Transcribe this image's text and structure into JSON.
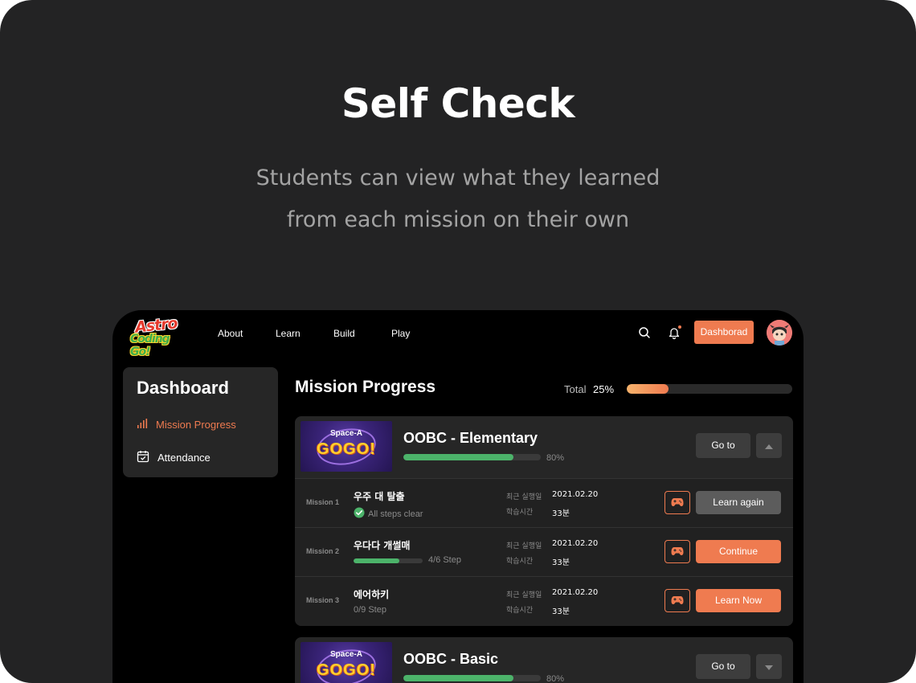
{
  "hero": {
    "title": "Self Check",
    "subtitle_line1": "Students can view what they learned",
    "subtitle_line2": "from each mission on their own"
  },
  "nav": {
    "logo_line1": "Astro",
    "logo_line2": "Coding Go!",
    "links": [
      "About",
      "Learn",
      "Build",
      "Play"
    ],
    "dashboard_button": "Dashborad",
    "accent_color": "#ef7b50"
  },
  "sidebar": {
    "title": "Dashboard",
    "items": [
      {
        "label": "Mission Progress",
        "icon": "bar-chart-icon",
        "active": true
      },
      {
        "label": "Attendance",
        "icon": "calendar-check-icon",
        "active": false
      }
    ]
  },
  "main": {
    "title": "Mission Progress",
    "total_label": "Total",
    "total_value": "25%",
    "total_fraction": 0.25
  },
  "courses": [
    {
      "thumb_line1": "Space-A",
      "thumb_line2": "GOGO!",
      "title": "OOBC - Elementary",
      "progress_label": "80%",
      "progress_fraction": 0.8,
      "goto_label": "Go to",
      "expanded": true,
      "missions": [
        {
          "label": "Mission 1",
          "name": "우주 대 탈출",
          "status": "All steps clear",
          "cleared": true,
          "recent_label": "최근 실행일",
          "recent_value": "2021.02.20",
          "time_label": "학습시간",
          "time_value": "33분",
          "action": "Learn again",
          "action_style": "grey"
        },
        {
          "label": "Mission 2",
          "name": "우다다 개썰매",
          "step": "4/6 Step",
          "step_fraction": 0.667,
          "recent_label": "최근 실행일",
          "recent_value": "2021.02.20",
          "time_label": "학습시간",
          "time_value": "33분",
          "action": "Continue",
          "action_style": "orange"
        },
        {
          "label": "Mission 3",
          "name": "에어하키",
          "step": "0/9 Step",
          "step_fraction": 0,
          "recent_label": "최근 실행일",
          "recent_value": "2021.02.20",
          "time_label": "학습시간",
          "time_value": "33분",
          "action": "Learn Now",
          "action_style": "orange"
        }
      ]
    },
    {
      "thumb_line1": "Space-A",
      "thumb_line2": "GOGO!",
      "title": "OOBC - Basic",
      "progress_label": "80%",
      "progress_fraction": 0.8,
      "goto_label": "Go to",
      "expanded": false
    }
  ]
}
